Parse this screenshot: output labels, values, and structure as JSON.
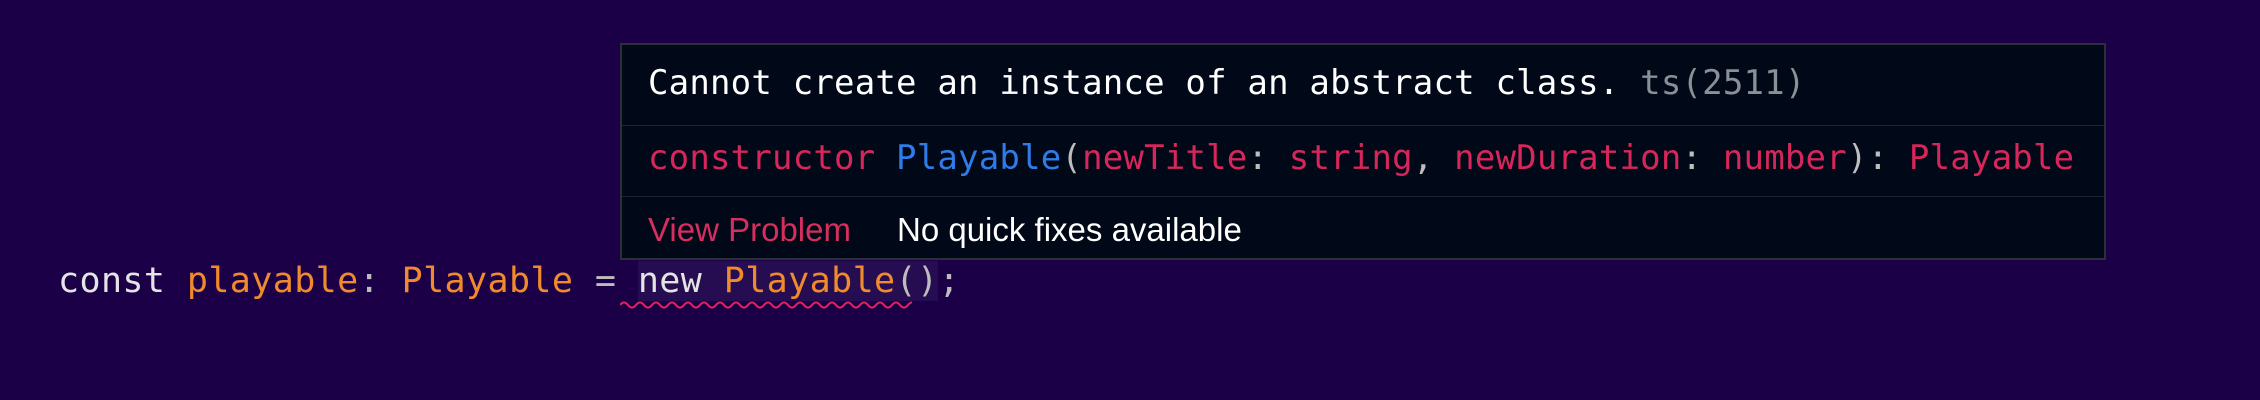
{
  "hover": {
    "message": "Cannot create an instance of an abstract class.",
    "error_code": "ts(2511)",
    "signature": {
      "keyword": "constructor",
      "name": "Playable",
      "open_paren": "(",
      "param1_name": "newTitle",
      "colon1": ": ",
      "param1_type": "string",
      "comma": ", ",
      "param2_name": "newDuration",
      "colon2": ": ",
      "param2_type": "number",
      "close_paren": ")",
      "colon3": ": ",
      "return_type": "Playable"
    },
    "actions": {
      "view_problem": "View Problem",
      "no_quick_fixes": "No quick fixes available"
    }
  },
  "code": {
    "keyword_const": "const",
    "variable": "playable",
    "colon": ":",
    "type": "Playable",
    "equals": "=",
    "keyword_new": "new",
    "class_name": "Playable",
    "parens": "()",
    "semicolon": ";"
  },
  "colors": {
    "background": "#1b0048",
    "hover_background": "#010817",
    "error_squiggle": "#e0245e",
    "orange": "#f08a2c",
    "pink": "#d6265b",
    "blue": "#2f7ce8"
  }
}
